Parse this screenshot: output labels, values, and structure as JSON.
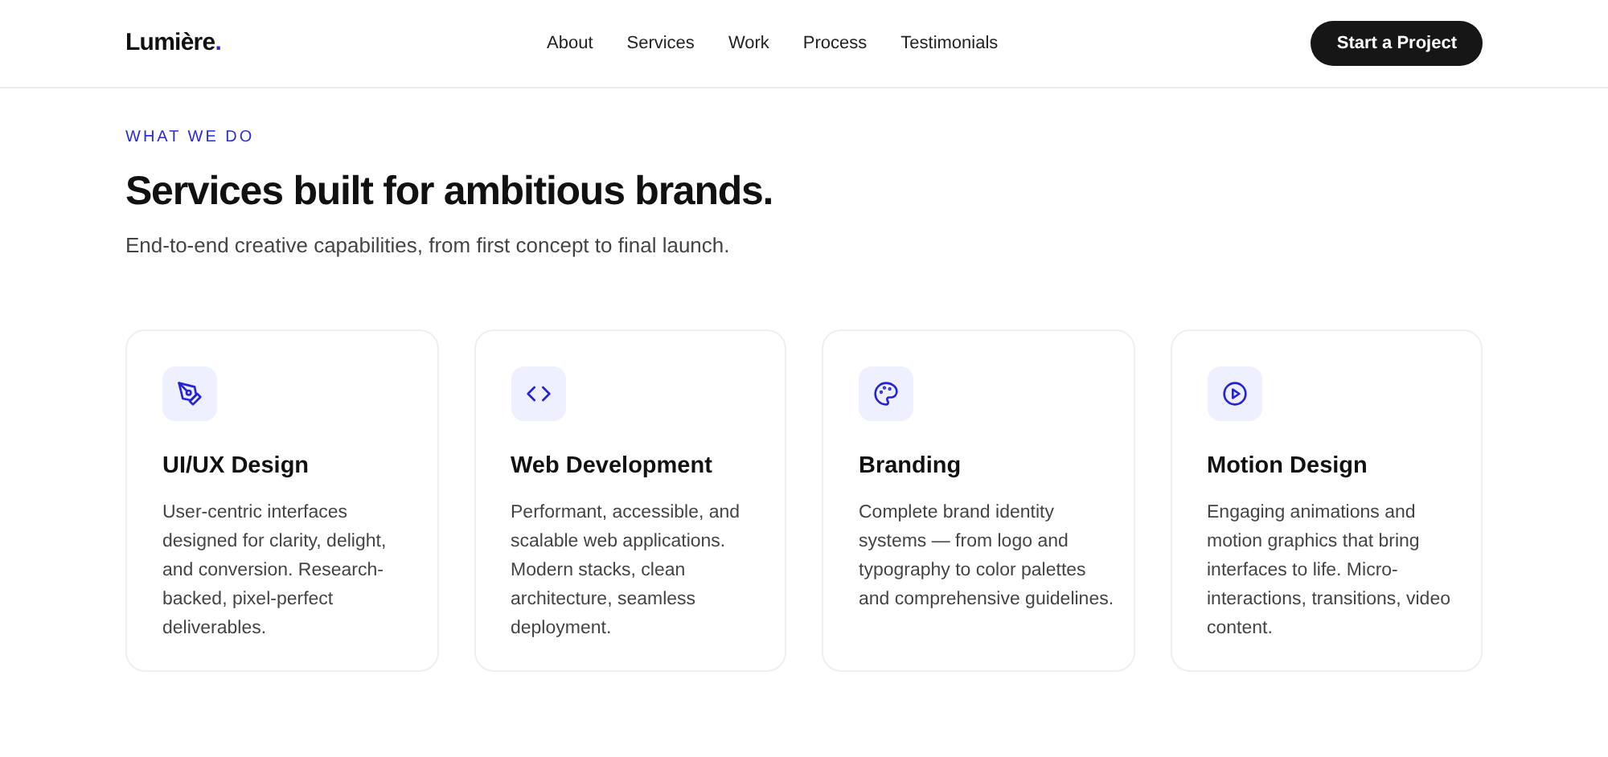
{
  "brand": {
    "name": "Lumière",
    "mark": "."
  },
  "nav": [
    {
      "label": "About"
    },
    {
      "label": "Services"
    },
    {
      "label": "Work"
    },
    {
      "label": "Process"
    },
    {
      "label": "Testimonials"
    }
  ],
  "cta": "Start a Project",
  "section": {
    "eyebrow": "WHAT WE DO",
    "title": "Services built for ambitious brands.",
    "subtitle": "End-to-end creative capabilities, from first concept to final launch."
  },
  "services": [
    {
      "kind": "pen",
      "title": "UI/UX Design",
      "description": "User-centric interfaces designed for clarity, delight, and conversion. Research-backed, pixel-perfect deliverables."
    },
    {
      "kind": "code",
      "title": "Web Development",
      "description": "Performant, accessible, and scalable web applications. Modern stacks, clean architecture, seamless deployment."
    },
    {
      "kind": "palette",
      "title": "Branding",
      "description": "Complete brand identity systems — from logo and typography to color palettes and comprehensive guidelines."
    },
    {
      "kind": "play",
      "title": "Motion Design",
      "description": "Engaging animations and motion graphics that bring interfaces to life. Micro-interactions, transitions, video content."
    }
  ]
}
